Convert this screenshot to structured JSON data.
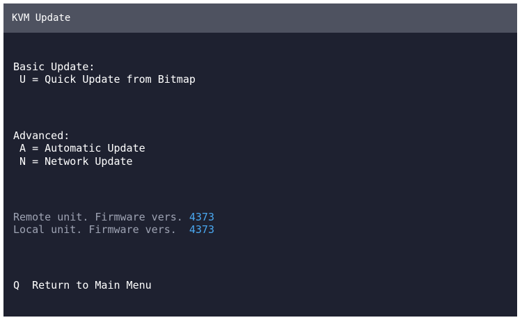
{
  "window": {
    "title": "KVM Update"
  },
  "basic": {
    "heading": "Basic Update:",
    "option_u": " U = Quick Update from Bitmap"
  },
  "advanced": {
    "heading": "Advanced:",
    "option_a": " A = Automatic Update",
    "option_n": " N = Network Update"
  },
  "firmware": {
    "remote_label": "Remote unit. Firmware vers. ",
    "remote_version": "4373",
    "local_label": "Local unit. Firmware vers.  ",
    "local_version": "4373"
  },
  "footer": {
    "key": "Q",
    "label": "  Return to Main Menu"
  },
  "colors": {
    "background": "#1e2130",
    "titlebar": "#4e5260",
    "text": "#ffffff",
    "dim_text": "#9ea3b3",
    "version_value": "#4aa8f0"
  }
}
